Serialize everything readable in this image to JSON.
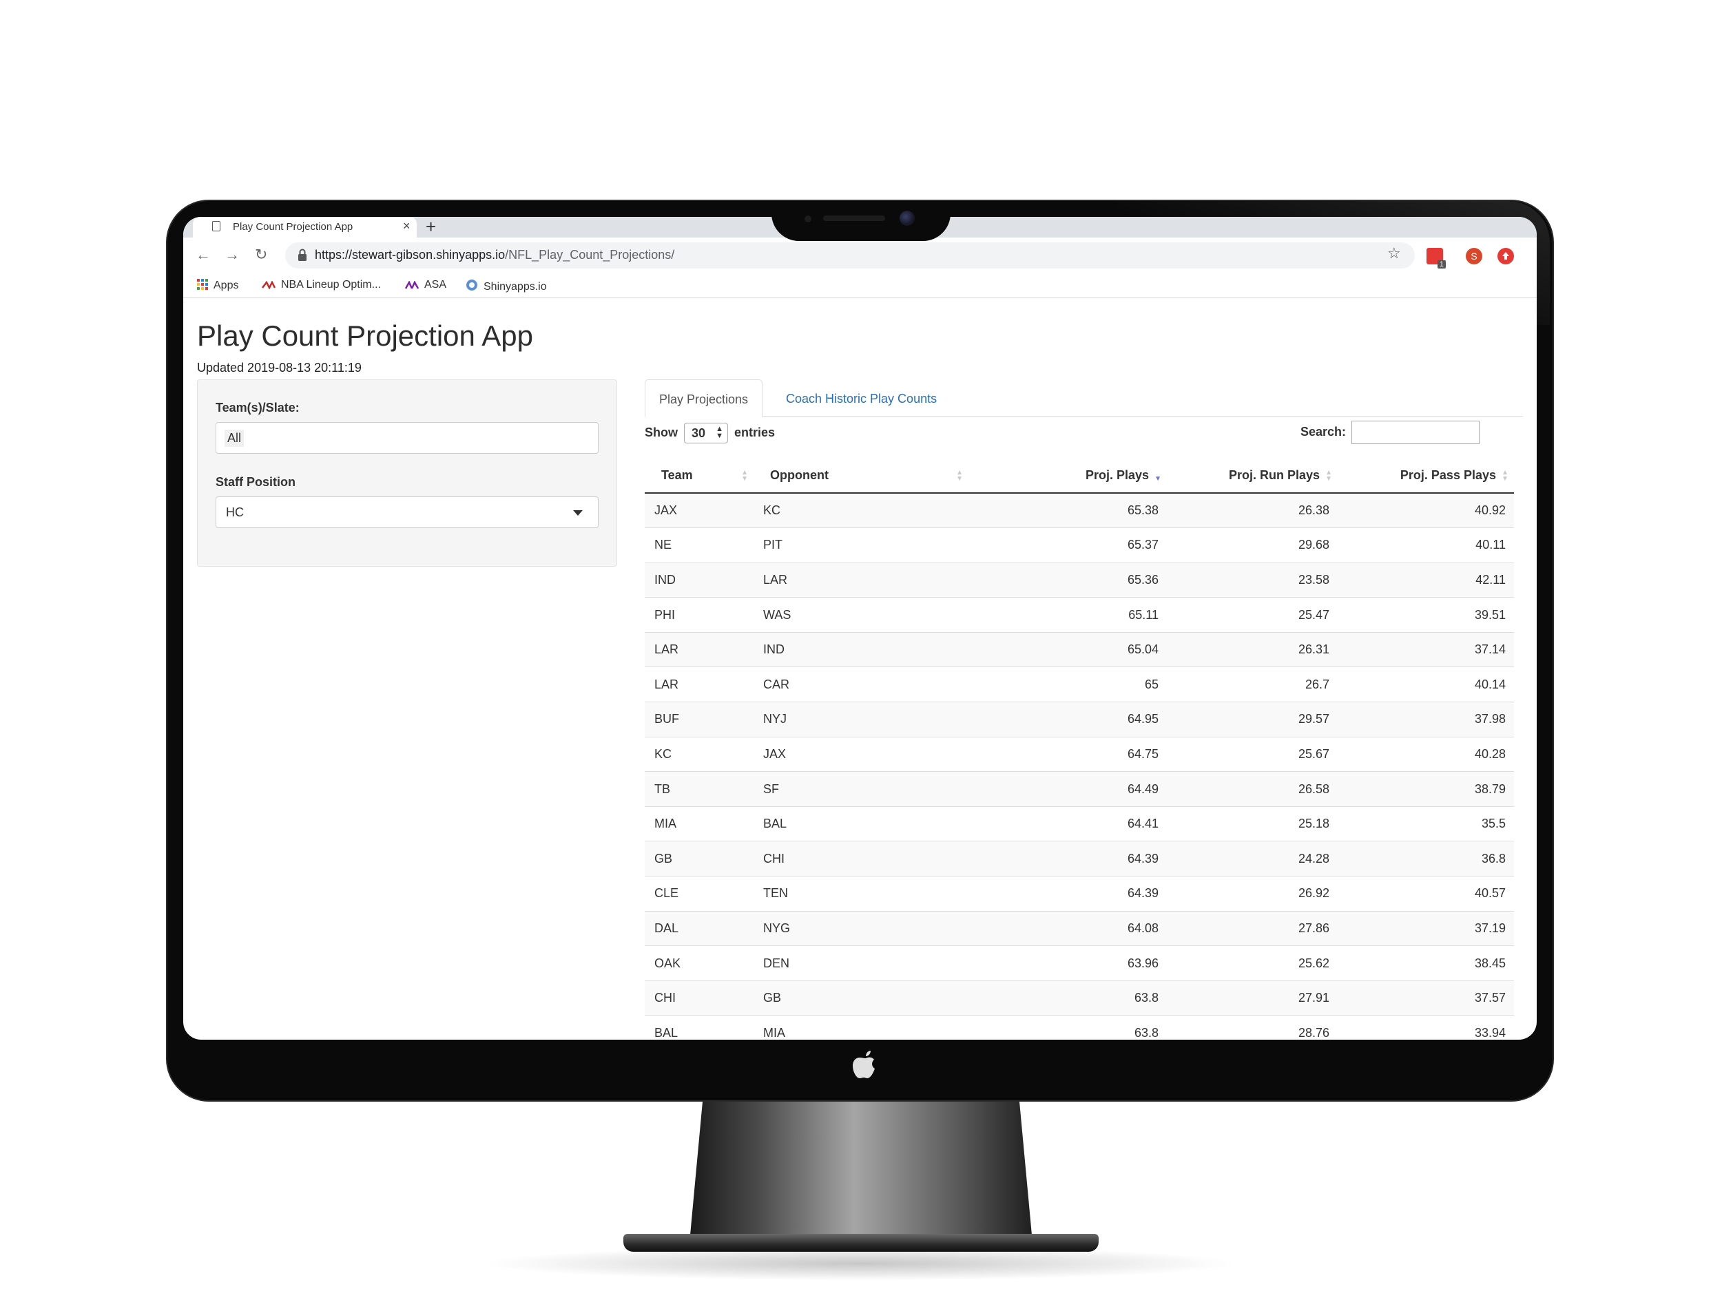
{
  "browser": {
    "tab_title": "Play Count Projection App",
    "tab_close": "×",
    "new_tab": "+",
    "back": "←",
    "forward": "→",
    "reload": "↻",
    "url_domain": "https://stewart-gibson.shinyapps.io",
    "url_path": "/NFL_Play_Count_Projections/",
    "star": "☆",
    "ext_badge": "1",
    "profile_initial": "S",
    "bookmarks": [
      {
        "label": "Apps",
        "icon": "apps-grid-icon"
      },
      {
        "label": "NBA Lineup Optim...",
        "icon": "nba-logo-icon"
      },
      {
        "label": "ASA",
        "icon": "asa-logo-icon"
      },
      {
        "label": "Shinyapps.io",
        "icon": "shinyapps-globe-icon"
      }
    ]
  },
  "app": {
    "title": "Play Count Projection App",
    "updated": "Updated 2019-08-13 20:11:19",
    "filters": {
      "team_label": "Team(s)/Slate:",
      "team_value": "All",
      "staff_label": "Staff Position",
      "staff_value": "HC"
    },
    "tabs": [
      {
        "label": "Play Projections",
        "active": true
      },
      {
        "label": "Coach Historic Play Counts",
        "active": false
      }
    ],
    "table_controls": {
      "show": "Show",
      "length": "30",
      "entries": "entries",
      "search_label": "Search:"
    },
    "table": {
      "columns": [
        "Team",
        "Opponent",
        "Proj. Plays",
        "Proj. Run Plays",
        "Proj. Pass Plays"
      ],
      "sorted_column": "Proj. Plays",
      "sort_direction": "desc",
      "rows": [
        [
          "JAX",
          "KC",
          "65.38",
          "26.38",
          "40.92"
        ],
        [
          "NE",
          "PIT",
          "65.37",
          "29.68",
          "40.11"
        ],
        [
          "IND",
          "LAR",
          "65.36",
          "23.58",
          "42.11"
        ],
        [
          "PHI",
          "WAS",
          "65.11",
          "25.47",
          "39.51"
        ],
        [
          "LAR",
          "IND",
          "65.04",
          "26.31",
          "37.14"
        ],
        [
          "LAR",
          "CAR",
          "65",
          "26.7",
          "40.14"
        ],
        [
          "BUF",
          "NYJ",
          "64.95",
          "29.57",
          "37.98"
        ],
        [
          "KC",
          "JAX",
          "64.75",
          "25.67",
          "40.28"
        ],
        [
          "TB",
          "SF",
          "64.49",
          "26.58",
          "38.79"
        ],
        [
          "MIA",
          "BAL",
          "64.41",
          "25.18",
          "35.5"
        ],
        [
          "GB",
          "CHI",
          "64.39",
          "24.28",
          "36.8"
        ],
        [
          "CLE",
          "TEN",
          "64.39",
          "26.92",
          "40.57"
        ],
        [
          "DAL",
          "NYG",
          "64.08",
          "27.86",
          "37.19"
        ],
        [
          "OAK",
          "DEN",
          "63.96",
          "25.62",
          "38.45"
        ],
        [
          "CHI",
          "GB",
          "63.8",
          "27.91",
          "37.57"
        ],
        [
          "BAL",
          "MIA",
          "63.8",
          "28.76",
          "33.94"
        ]
      ]
    }
  },
  "colors": {
    "link": "#2a6fb3",
    "sort_active": "#6672d8",
    "profile": "#d9472b",
    "ext_red": "#e53935"
  }
}
